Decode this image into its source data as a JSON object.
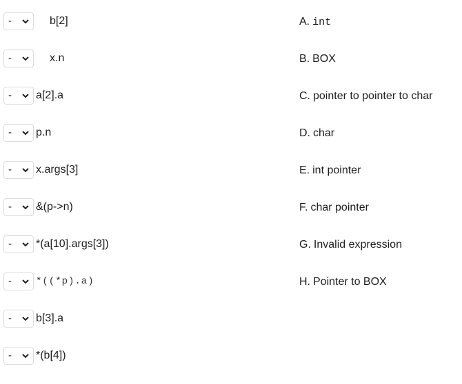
{
  "matching": {
    "rows": [
      {
        "selected": "-",
        "expression": "b[2]"
      },
      {
        "selected": "-",
        "expression": "x.n"
      },
      {
        "selected": "-",
        "expression": "a[2].a"
      },
      {
        "selected": "-",
        "expression": "p.n"
      },
      {
        "selected": "-",
        "expression": "x.args[3]"
      },
      {
        "selected": "-",
        "expression": "&(p->n)"
      },
      {
        "selected": "-",
        "expression": "*(a[10].args[3])"
      },
      {
        "selected": "-",
        "expression": "*((*p).a)"
      },
      {
        "selected": "-",
        "expression": "b[3].a"
      },
      {
        "selected": "-",
        "expression": "*(b[4])"
      }
    ],
    "options": [
      {
        "letter": "A.",
        "text": "int"
      },
      {
        "letter": "B.",
        "text": "BOX"
      },
      {
        "letter": "C.",
        "text": "pointer to pointer to char"
      },
      {
        "letter": "D.",
        "text": "char"
      },
      {
        "letter": "E.",
        "text": "int pointer"
      },
      {
        "letter": "F.",
        "text": "char pointer"
      },
      {
        "letter": "G.",
        "text": "Invalid expression"
      },
      {
        "letter": "H.",
        "text": "Pointer to BOX"
      }
    ]
  }
}
